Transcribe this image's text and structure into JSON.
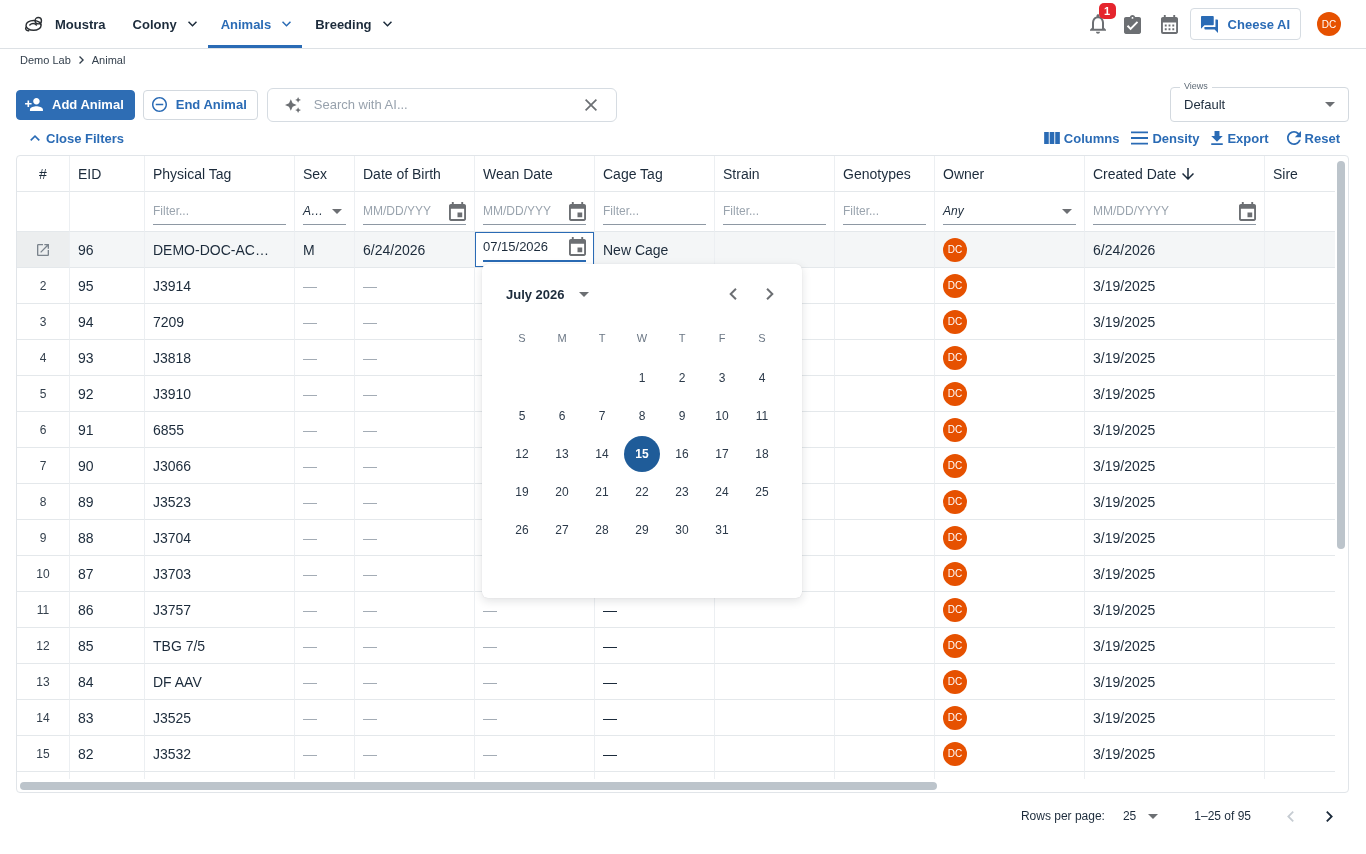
{
  "app_bar": {
    "brand": "Moustra",
    "nav": [
      {
        "label": "Colony",
        "selected": false
      },
      {
        "label": "Animals",
        "selected": true
      },
      {
        "label": "Breeding",
        "selected": false
      }
    ],
    "notification_count": "1",
    "assistant_button": "Cheese AI",
    "avatar": "DC"
  },
  "breadcrumb": [
    "Demo Lab",
    "Animal"
  ],
  "toolbar": {
    "buttons": [
      {
        "label": "Add Animal",
        "kind": "primary"
      },
      {
        "label": "End Animal",
        "kind": "outlined"
      }
    ],
    "search": {
      "placeholder": "Search with AI..."
    },
    "views": {
      "label": "Views",
      "value": "Default"
    },
    "filter_toggle": "Close Filters",
    "table_actions": [
      "Columns",
      "Density",
      "Export",
      "Reset"
    ]
  },
  "table": {
    "columns": [
      {
        "label": "#"
      },
      {
        "label": "EID"
      },
      {
        "label": "Physical Tag",
        "filter": {
          "kind": "text",
          "placeholder": "Filter..."
        }
      },
      {
        "label": "Sex",
        "filter": {
          "kind": "select",
          "value": "A…"
        }
      },
      {
        "label": "Date of Birth",
        "filter": {
          "kind": "date",
          "placeholder": "MM/DD/YYY"
        }
      },
      {
        "label": "Wean Date",
        "filter": {
          "kind": "date",
          "placeholder": "MM/DD/YYY"
        }
      },
      {
        "label": "Cage Tag",
        "filter": {
          "kind": "text",
          "placeholder": "Filter..."
        }
      },
      {
        "label": "Strain",
        "filter": {
          "kind": "text",
          "placeholder": "Filter..."
        }
      },
      {
        "label": "Genotypes",
        "filter": {
          "kind": "text",
          "placeholder": "Filter..."
        }
      },
      {
        "label": "Owner",
        "filter": {
          "kind": "select",
          "value": "Any"
        }
      },
      {
        "label": "Created Date",
        "sort_descending": true,
        "filter": {
          "kind": "date",
          "placeholder": "MM/DD/YYYY"
        }
      },
      {
        "label": "Sire"
      }
    ],
    "rows": [
      {
        "editing": true,
        "eid": "96",
        "physical_tag": "DEMO-DOC-AC…",
        "sex": "M",
        "date_of_birth": "6/24/2026",
        "wean_date": {
          "kind": "input",
          "value": "07/15/2026"
        },
        "cage_tag": "New Cage",
        "owner": "DC",
        "created_date": "6/24/2026"
      },
      {
        "editing": false,
        "number": "2",
        "eid": "95",
        "physical_tag": "J3914",
        "sex": {
          "kind": "muted",
          "text": "—"
        },
        "date_of_birth": {
          "kind": "muted",
          "text": "—"
        },
        "owner": "DC",
        "created_date": "3/19/2025"
      },
      {
        "editing": false,
        "number": "3",
        "eid": "94",
        "physical_tag": "7209",
        "sex": {
          "kind": "muted",
          "text": "—"
        },
        "date_of_birth": {
          "kind": "muted",
          "text": "—"
        },
        "owner": "DC",
        "created_date": "3/19/2025"
      },
      {
        "editing": false,
        "number": "4",
        "eid": "93",
        "physical_tag": "J3818",
        "sex": {
          "kind": "muted",
          "text": "—"
        },
        "date_of_birth": {
          "kind": "muted",
          "text": "—"
        },
        "owner": "DC",
        "created_date": "3/19/2025"
      },
      {
        "editing": false,
        "number": "5",
        "eid": "92",
        "physical_tag": "J3910",
        "sex": {
          "kind": "muted",
          "text": "—"
        },
        "date_of_birth": {
          "kind": "muted",
          "text": "—"
        },
        "owner": "DC",
        "created_date": "3/19/2025"
      },
      {
        "editing": false,
        "number": "6",
        "eid": "91",
        "physical_tag": "6855",
        "sex": {
          "kind": "muted",
          "text": "—"
        },
        "date_of_birth": {
          "kind": "muted",
          "text": "—"
        },
        "owner": "DC",
        "created_date": "3/19/2025"
      },
      {
        "editing": false,
        "number": "7",
        "eid": "90",
        "physical_tag": "J3066",
        "sex": {
          "kind": "muted",
          "text": "—"
        },
        "date_of_birth": {
          "kind": "muted",
          "text": "—"
        },
        "owner": "DC",
        "created_date": "3/19/2025"
      },
      {
        "editing": false,
        "number": "8",
        "eid": "89",
        "physical_tag": "J3523",
        "sex": {
          "kind": "muted",
          "text": "—"
        },
        "date_of_birth": {
          "kind": "muted",
          "text": "—"
        },
        "owner": "DC",
        "created_date": "3/19/2025"
      },
      {
        "editing": false,
        "number": "9",
        "eid": "88",
        "physical_tag": "J3704",
        "sex": {
          "kind": "muted",
          "text": "—"
        },
        "date_of_birth": {
          "kind": "muted",
          "text": "—"
        },
        "owner": "DC",
        "created_date": "3/19/2025"
      },
      {
        "editing": false,
        "number": "10",
        "eid": "87",
        "physical_tag": "J3703",
        "sex": {
          "kind": "muted",
          "text": "—"
        },
        "date_of_birth": {
          "kind": "muted",
          "text": "—"
        },
        "owner": "DC",
        "created_date": "3/19/2025"
      },
      {
        "editing": false,
        "number": "11",
        "eid": "86",
        "physical_tag": "J3757",
        "sex": {
          "kind": "muted",
          "text": "—"
        },
        "date_of_birth": {
          "kind": "muted",
          "text": "—"
        },
        "wean_date": {
          "kind": "muted",
          "text": "—"
        },
        "cage_tag": "—",
        "owner": "DC",
        "created_date": "3/19/2025"
      },
      {
        "editing": false,
        "number": "12",
        "eid": "85",
        "physical_tag": "TBG 7/5",
        "sex": {
          "kind": "muted",
          "text": "—"
        },
        "date_of_birth": {
          "kind": "muted",
          "text": "—"
        },
        "wean_date": {
          "kind": "muted",
          "text": "—"
        },
        "cage_tag": "—",
        "owner": "DC",
        "created_date": "3/19/2025"
      },
      {
        "editing": false,
        "number": "13",
        "eid": "84",
        "physical_tag": "DF AAV",
        "sex": {
          "kind": "muted",
          "text": "—"
        },
        "date_of_birth": {
          "kind": "muted",
          "text": "—"
        },
        "wean_date": {
          "kind": "muted",
          "text": "—"
        },
        "cage_tag": "—",
        "owner": "DC",
        "created_date": "3/19/2025"
      },
      {
        "editing": false,
        "number": "14",
        "eid": "83",
        "physical_tag": "J3525",
        "sex": {
          "kind": "muted",
          "text": "—"
        },
        "date_of_birth": {
          "kind": "muted",
          "text": "—"
        },
        "wean_date": {
          "kind": "muted",
          "text": "—"
        },
        "cage_tag": "—",
        "owner": "DC",
        "created_date": "3/19/2025"
      },
      {
        "editing": false,
        "number": "15",
        "eid": "82",
        "physical_tag": "J3532",
        "sex": {
          "kind": "muted",
          "text": "—"
        },
        "date_of_birth": {
          "kind": "muted",
          "text": "—"
        },
        "wean_date": {
          "kind": "muted",
          "text": "—"
        },
        "cage_tag": "—",
        "owner": "DC",
        "created_date": "3/19/2025"
      }
    ]
  },
  "date_picker": {
    "month": "July 2026",
    "weekdays": [
      "S",
      "M",
      "T",
      "W",
      "T",
      "F",
      "S"
    ],
    "weeks": [
      [
        {
          "label": "1",
          "selected": false
        },
        {
          "label": "2",
          "selected": false
        },
        {
          "label": "3",
          "selected": false
        },
        {
          "label": "4",
          "selected": false
        }
      ],
      [
        {
          "label": "5",
          "selected": false
        },
        {
          "label": "6",
          "selected": false
        },
        {
          "label": "7",
          "selected": false
        },
        {
          "label": "8",
          "selected": false
        },
        {
          "label": "9",
          "selected": false
        },
        {
          "label": "10",
          "selected": false
        },
        {
          "label": "11",
          "selected": false
        }
      ],
      [
        {
          "label": "12",
          "selected": false
        },
        {
          "label": "13",
          "selected": false
        },
        {
          "label": "14",
          "selected": false
        },
        {
          "label": "15",
          "selected": true
        },
        {
          "label": "16",
          "selected": false
        },
        {
          "label": "17",
          "selected": false
        },
        {
          "label": "18",
          "selected": false
        }
      ],
      [
        {
          "label": "19",
          "selected": false
        },
        {
          "label": "20",
          "selected": false
        },
        {
          "label": "21",
          "selected": false
        },
        {
          "label": "22",
          "selected": false
        },
        {
          "label": "23",
          "selected": false
        },
        {
          "label": "24",
          "selected": false
        },
        {
          "label": "25",
          "selected": false
        }
      ],
      [
        {
          "label": "26",
          "selected": false
        },
        {
          "label": "27",
          "selected": false
        },
        {
          "label": "28",
          "selected": false
        },
        {
          "label": "29",
          "selected": false
        },
        {
          "label": "30",
          "selected": false
        },
        {
          "label": "31",
          "selected": false
        }
      ]
    ]
  },
  "pagination": {
    "rows_per_page_label": "Rows per page:",
    "rows_per_page": "25",
    "range": "1–25 of 95",
    "previous": {
      "disabled": true
    },
    "next": {
      "disabled": false
    }
  }
}
